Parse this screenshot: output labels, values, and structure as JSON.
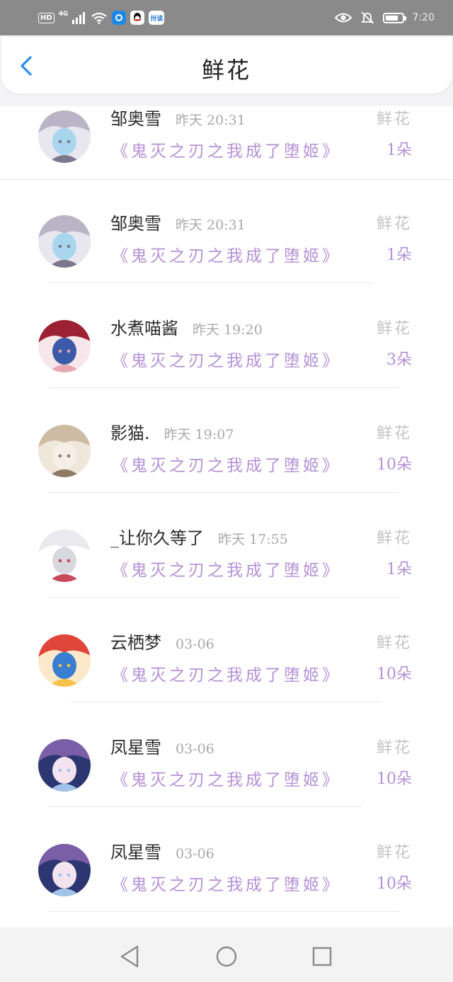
{
  "status_bar": {
    "network_hd": "HD",
    "network_type": "4G",
    "app_badge_label": "卅读",
    "time": "7:20",
    "icons": [
      "signal-icon",
      "wifi-icon",
      "app-icon",
      "qq-icon",
      "reader-app-icon",
      "eye-icon",
      "mute-icon",
      "battery-icon"
    ]
  },
  "header": {
    "title": "鲜花",
    "back_icon": "chevron-left-icon",
    "accent_color": "#2a8df2"
  },
  "list": {
    "gift_color": "#b591d6",
    "items": [
      {
        "name": "邹奥雪",
        "time": "昨天 20:31",
        "book": "《鬼灭之刃之我成了堕姬》",
        "gift": "鲜花",
        "count": "1朵",
        "avatar": "avatar-gray-cat"
      },
      {
        "name": "邹奥雪",
        "time": "昨天 20:31",
        "book": "《鬼灭之刃之我成了堕姬》",
        "gift": "鲜花",
        "count": "1朵",
        "avatar": "avatar-gray-cat"
      },
      {
        "name": "水煮喵酱",
        "time": "昨天 19:20",
        "book": "《鬼灭之刃之我成了堕姬》",
        "gift": "鲜花",
        "count": "3朵",
        "avatar": "avatar-red-hair"
      },
      {
        "name": "影猫.",
        "time": "昨天 19:07",
        "book": "《鬼灭之刃之我成了堕姬》",
        "gift": "鲜花",
        "count": "10朵",
        "avatar": "avatar-beige"
      },
      {
        "name": "_让你久等了",
        "time": "昨天 17:55",
        "book": "《鬼灭之刃之我成了堕姬》",
        "gift": "鲜花",
        "count": "1朵",
        "avatar": "avatar-white-hair"
      },
      {
        "name": "云栖梦",
        "time": "03-06",
        "book": "《鬼灭之刃之我成了堕姬》",
        "gift": "鲜花",
        "count": "10朵",
        "avatar": "avatar-colorful"
      },
      {
        "name": "凤星雪",
        "time": "03-06",
        "book": "《鬼灭之刃之我成了堕姬》",
        "gift": "鲜花",
        "count": "10朵",
        "avatar": "avatar-blue-purple"
      },
      {
        "name": "凤星雪",
        "time": "03-06",
        "book": "《鬼灭之刃之我成了堕姬》",
        "gift": "鲜花",
        "count": "10朵",
        "avatar": "avatar-blue-purple"
      }
    ]
  },
  "nav_bar": {
    "buttons": [
      "back-triangle-icon",
      "home-circle-icon",
      "recents-square-icon"
    ]
  },
  "battery_level": 0.75
}
